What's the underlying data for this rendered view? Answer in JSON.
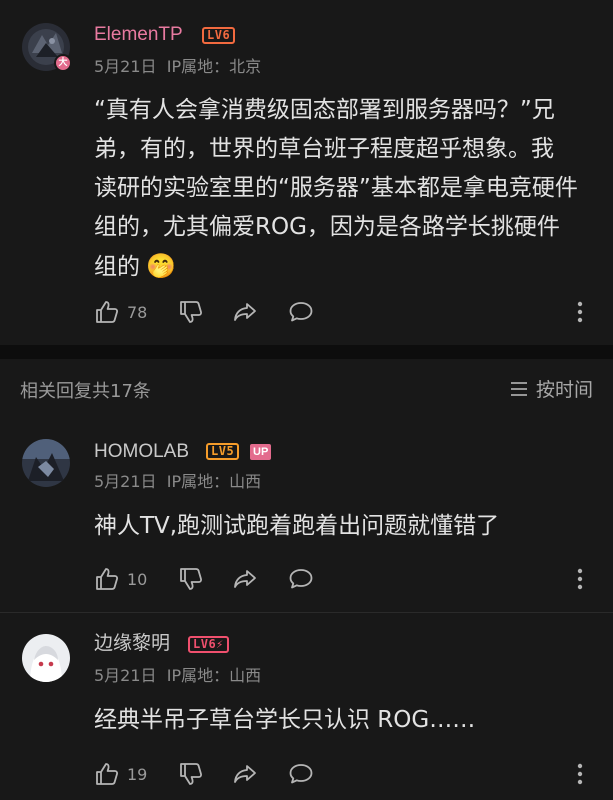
{
  "main_comment": {
    "username": "ElemenTP",
    "level_badge": "LV6",
    "avatar_badge": "大",
    "date": "5月21日",
    "ip_location": "IP属地：北京",
    "lines": [
      "“真有人会拿消费级固态部署到服务器吗？”兄",
      "弟，有的，世界的草台班子程度超乎想象。我",
      "读研的实验室里的“服务器”基本都是拿电竞硬件",
      "组的，尤其偏爱ROG，因为是各路学长挑硬件",
      "组的"
    ],
    "emoji": "🤭",
    "like_count": "78"
  },
  "replies_header": {
    "count_text": "相关回复共17条",
    "sort_label": "按时间"
  },
  "replies": [
    {
      "username": "HOMOLAB",
      "level_badge": "LV5",
      "up_badge": "UP",
      "date": "5月21日",
      "ip_location": "IP属地：山西",
      "text": "神人TV,跑测试跑着跑着出问题就懂错了",
      "like_count": "10"
    },
    {
      "username": "边缘黎明",
      "level_badge": "LV6⚡",
      "date": "5月21日",
      "ip_location": "IP属地：山西",
      "text": "经典半吊子草台学长只认识 ROG……",
      "like_count": "19"
    }
  ],
  "colors": {
    "background": "#181818",
    "vip_name": "#e87aa0",
    "lv6": "#f26a3f",
    "lv5": "#f59c2a",
    "up_badge": "#e36b8d"
  },
  "icons": [
    "thumbs-up-icon",
    "thumbs-down-icon",
    "share-icon",
    "comment-icon",
    "more-icon",
    "sort-icon"
  ]
}
